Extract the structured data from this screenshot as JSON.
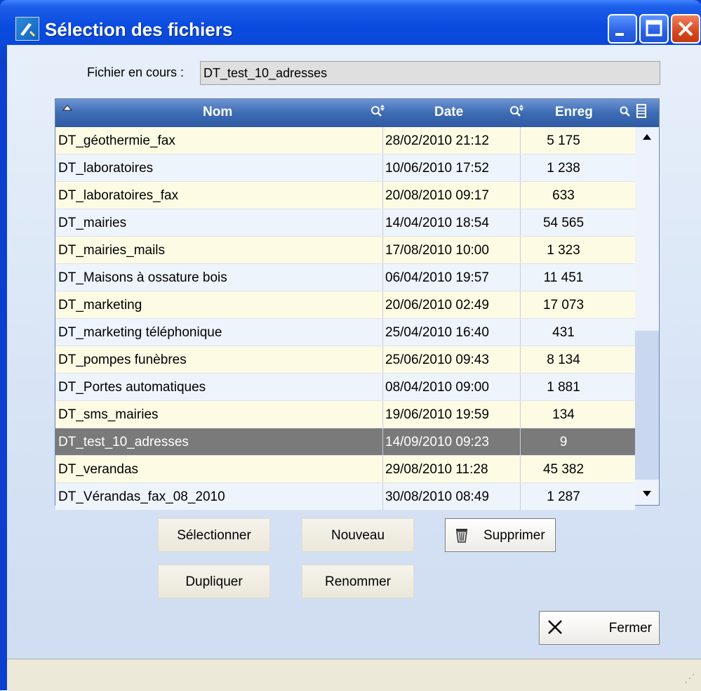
{
  "window": {
    "title": "Sélection des fichiers",
    "controls": [
      "minimize",
      "maximize",
      "close"
    ]
  },
  "current_file": {
    "label": "Fichier en cours :",
    "value": "DT_test_10_adresses"
  },
  "grid": {
    "columns": [
      "Nom",
      "Date",
      "Enreg"
    ],
    "rows": [
      {
        "nom": "DT_géothermie_fax",
        "date": "28/02/2010   21:12",
        "enreg": "5 175"
      },
      {
        "nom": "DT_laboratoires",
        "date": "10/06/2010   17:52",
        "enreg": "1 238"
      },
      {
        "nom": "DT_laboratoires_fax",
        "date": "20/08/2010   09:17",
        "enreg": "633"
      },
      {
        "nom": "DT_mairies",
        "date": "14/04/2010   18:54",
        "enreg": "54 565"
      },
      {
        "nom": "DT_mairies_mails",
        "date": "17/08/2010   10:00",
        "enreg": "1 323"
      },
      {
        "nom": "DT_Maisons à ossature bois",
        "date": "06/04/2010   19:57",
        "enreg": "11 451"
      },
      {
        "nom": "DT_marketing",
        "date": "20/06/2010   02:49",
        "enreg": "17 073"
      },
      {
        "nom": "DT_marketing téléphonique",
        "date": "25/04/2010   16:40",
        "enreg": "431"
      },
      {
        "nom": "DT_pompes funèbres",
        "date": "25/06/2010   09:43",
        "enreg": "8 134"
      },
      {
        "nom": "DT_Portes automatiques",
        "date": "08/04/2010   09:00",
        "enreg": "1 881"
      },
      {
        "nom": "DT_sms_mairies",
        "date": "19/06/2010   19:59",
        "enreg": "134"
      },
      {
        "nom": "DT_test_10_adresses",
        "date": "14/09/2010   09:23",
        "enreg": "9",
        "selected": true
      },
      {
        "nom": "DT_verandas",
        "date": "29/08/2010   11:28",
        "enreg": "45 382"
      },
      {
        "nom": "DT_Vérandas_fax_08_2010",
        "date": "30/08/2010   08:49",
        "enreg": "1 287"
      }
    ]
  },
  "buttons": {
    "select": "Sélectionner",
    "new": "Nouveau",
    "delete": "Supprimer",
    "duplicate": "Dupliquer",
    "rename": "Renommer",
    "close": "Fermer"
  },
  "colors": {
    "title_bar": "#0a4be0",
    "header": "#3d6cb6",
    "row_even": "#fefbe4",
    "row_odd": "#eef4fc",
    "row_selected": "#7a7a7a"
  }
}
